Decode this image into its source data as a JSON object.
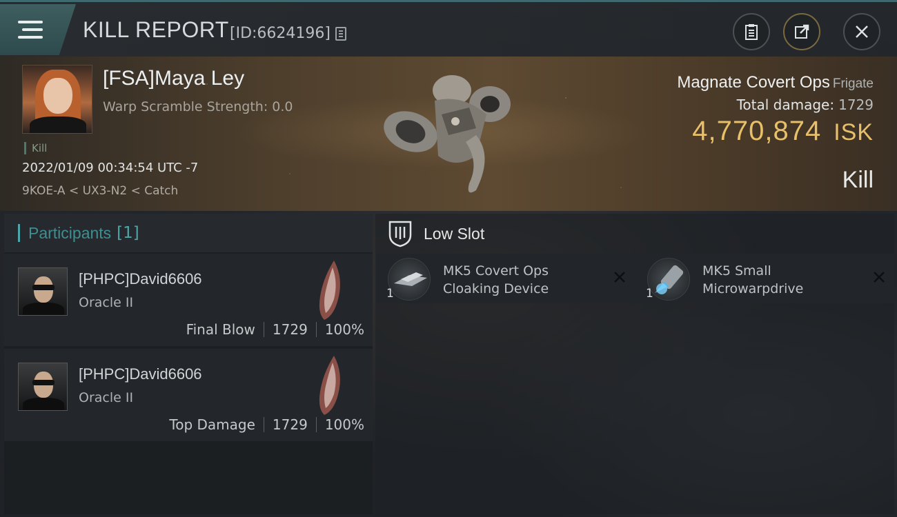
{
  "header": {
    "title": "KILL REPORT",
    "report_id": "[ID:6624196]"
  },
  "victim": {
    "name": "[FSA]Maya Ley",
    "warp_scramble": "Warp Scramble Strength: 0.0",
    "tag": "Kill",
    "datetime": "2022/01/09 00:34:54 UTC -7",
    "location": "9KOE-A < UX3-N2 < Catch",
    "ship": "Magnate Covert Ops",
    "ship_class": "Frigate",
    "total_damage_label": "Total damage:",
    "total_damage": "1729",
    "isk_value": "4,770,874",
    "isk_unit": "ISK",
    "result": "Kill"
  },
  "participants": {
    "label": "Participants",
    "count": "[1]",
    "rows": [
      {
        "name": "[PHPC]David6606",
        "ship": "Oracle II",
        "role": "Final Blow",
        "damage": "1729",
        "percent": "100%"
      },
      {
        "name": "[PHPC]David6606",
        "ship": "Oracle II",
        "role": "Top Damage",
        "damage": "1729",
        "percent": "100%"
      }
    ]
  },
  "slots": {
    "label": "Low Slot",
    "modules": [
      {
        "name_line1": "MK5 Covert Ops",
        "name_line2": "Cloaking Device",
        "qty": "1",
        "icon": "cloak-module-icon"
      },
      {
        "name_line1": "MK5 Small",
        "name_line2": "Microwarpdrive",
        "qty": "1",
        "icon": "microwarpdrive-module-icon"
      }
    ]
  },
  "colors": {
    "accent": "#4fa6a8",
    "isk": "#e8c06a"
  }
}
